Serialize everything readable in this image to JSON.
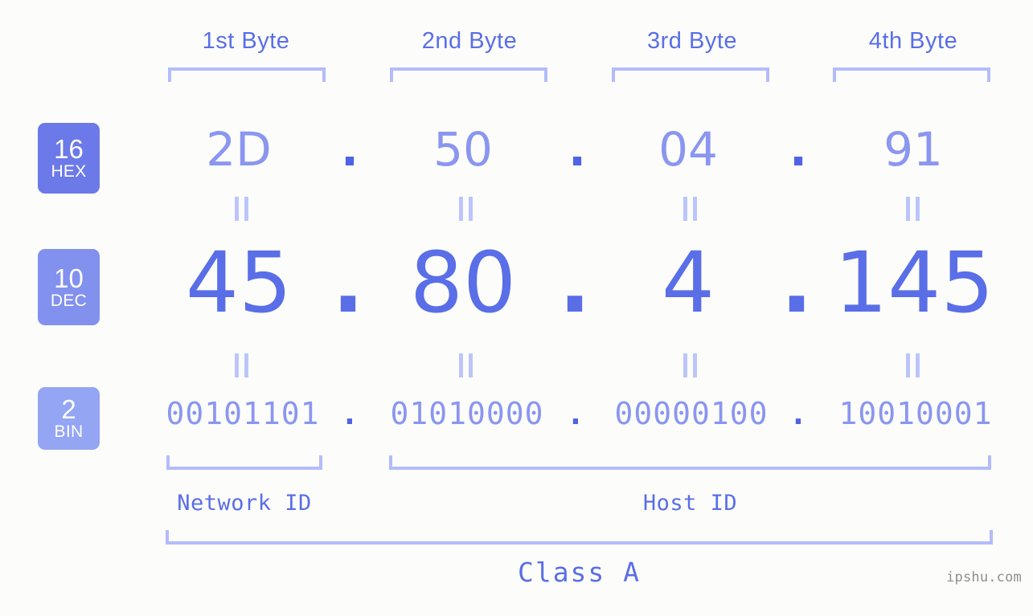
{
  "byte_headers": [
    {
      "label": "1st Byte"
    },
    {
      "label": "2nd Byte"
    },
    {
      "label": "3rd Byte"
    },
    {
      "label": "4th Byte"
    }
  ],
  "bases": {
    "hex": {
      "number": "16",
      "name": "HEX",
      "color": "#6c79e8"
    },
    "dec": {
      "number": "10",
      "name": "DEC",
      "color": "#8290ee"
    },
    "bin": {
      "number": "2",
      "name": "BIN",
      "color": "#94a5f4"
    }
  },
  "separator": ".",
  "rows": {
    "hex": {
      "values": [
        "2D",
        "50",
        "04",
        "91"
      ]
    },
    "dec": {
      "values": [
        "45",
        "80",
        "4",
        "145"
      ]
    },
    "bin": {
      "values": [
        "00101101",
        "01010000",
        "00000100",
        "10010001"
      ]
    }
  },
  "equality_symbol": "=",
  "sections": {
    "network_id": "Network ID",
    "host_id": "Host ID",
    "class": "Class A"
  },
  "watermark": "ipshu.com",
  "colors": {
    "background": "#fcfdfa",
    "accent_strong": "#5a6ee8",
    "accent_light": "#8a96f0",
    "bracket": "#b3bcfb",
    "equals": "#bcc5fb",
    "watermark": "#8e8e8e"
  }
}
